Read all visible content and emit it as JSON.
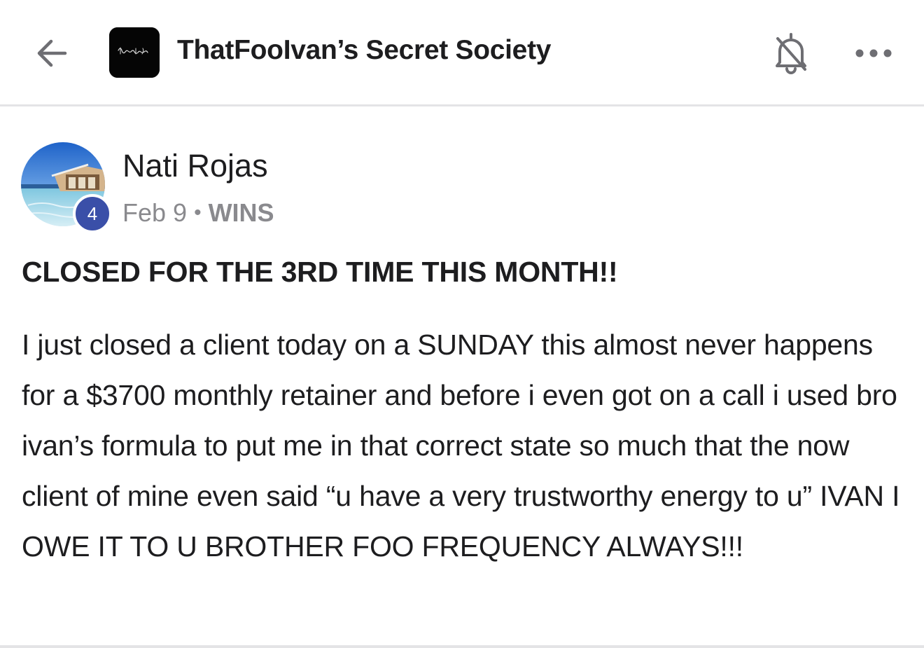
{
  "header": {
    "back_icon": "arrow-left-icon",
    "group_logo_text": "ThatFooIvan",
    "group_title": "ThatFooIvan’s Secret Society",
    "bell_icon": "bell-off-icon",
    "more_icon": "more-horizontal-icon"
  },
  "post": {
    "author_name": "Nati Rojas",
    "author_level": "4",
    "date": "Feb 9",
    "separator": "•",
    "category": "WINS",
    "title": "CLOSED FOR THE 3RD TIME THIS MONTH!!",
    "body": "I just closed a client today on a SUNDAY this almost never happens for a $3700 monthly retainer and before i even got on a call i used bro ivan’s formula to put me in that correct state so much that the now client of mine even said “u have a very trustworthy energy to u” IVAN I OWE IT TO U BROTHER FOO FREQUENCY ALWAYS!!!"
  },
  "colors": {
    "badge": "#3a4fa8",
    "meta_text": "#8a8a8e",
    "primary_text": "#1d1d1f",
    "divider": "#e4e4e6"
  }
}
